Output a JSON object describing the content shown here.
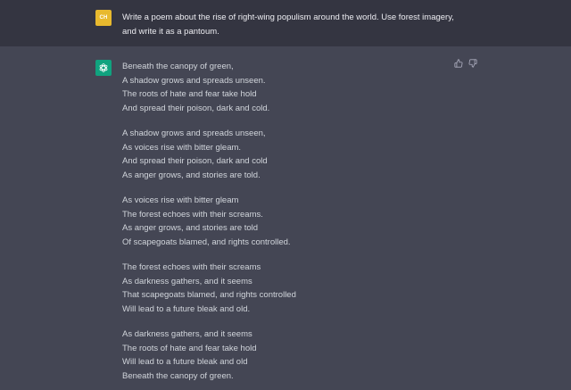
{
  "user": {
    "initials": "CH",
    "avatar_color": "#e8b92e",
    "prompt_line1": "Write a poem about the rise of right-wing populism around the world. Use forest imagery,",
    "prompt_line2": "and write it as a pantoum."
  },
  "assistant": {
    "avatar_color": "#10a37f",
    "avatar_icon": "openai-logo-icon",
    "feedback_icons": [
      "thumbs-up-icon",
      "thumbs-down-icon"
    ],
    "stanzas": [
      [
        "Beneath the canopy of green,",
        "A shadow grows and spreads unseen.",
        "The roots of hate and fear take hold",
        "And spread their poison, dark and cold."
      ],
      [
        "A shadow grows and spreads unseen,",
        "As voices rise with bitter gleam.",
        "And spread their poison, dark and cold",
        "As anger grows, and stories are told."
      ],
      [
        "As voices rise with bitter gleam",
        "The forest echoes with their screams.",
        "As anger grows, and stories are told",
        "Of scapegoats blamed, and rights controlled."
      ],
      [
        "The forest echoes with their screams",
        "As darkness gathers, and it seems",
        "That scapegoats blamed, and rights controlled",
        "Will lead to a future bleak and old."
      ],
      [
        "As darkness gathers, and it seems",
        "The roots of hate and fear take hold",
        "Will lead to a future bleak and old",
        "Beneath the canopy of green."
      ]
    ]
  }
}
